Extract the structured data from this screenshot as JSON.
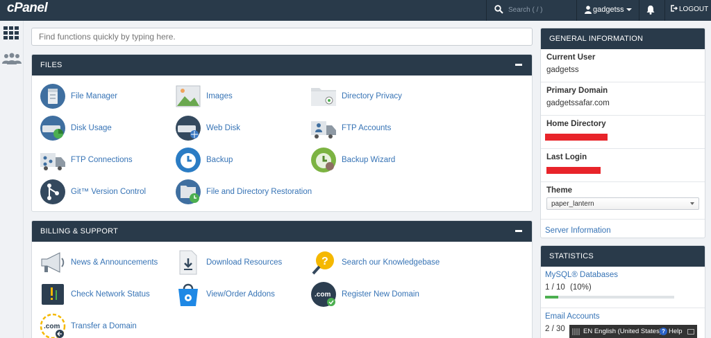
{
  "topbar": {
    "logo": "cPanel",
    "search_placeholder": "Search ( / )",
    "username": "gadgetss",
    "logout_label": "LOGOUT"
  },
  "quick_search": {
    "placeholder": "Find functions quickly by typing here."
  },
  "files": {
    "title": "FILES",
    "items": [
      {
        "label": "File Manager",
        "icon": "file-manager-icon"
      },
      {
        "label": "Images",
        "icon": "images-icon"
      },
      {
        "label": "Directory Privacy",
        "icon": "directory-privacy-icon"
      },
      {
        "label": "Disk Usage",
        "icon": "disk-usage-icon"
      },
      {
        "label": "Web Disk",
        "icon": "web-disk-icon"
      },
      {
        "label": "FTP Accounts",
        "icon": "ftp-accounts-icon"
      },
      {
        "label": "FTP Connections",
        "icon": "ftp-connections-icon"
      },
      {
        "label": "Backup",
        "icon": "backup-icon"
      },
      {
        "label": "Backup Wizard",
        "icon": "backup-wizard-icon"
      },
      {
        "label": "Git™ Version Control",
        "icon": "git-icon"
      },
      {
        "label": "File and Directory Restoration",
        "icon": "restoration-icon"
      }
    ]
  },
  "billing": {
    "title": "BILLING & SUPPORT",
    "items": [
      {
        "label": "News & Announcements",
        "icon": "megaphone-icon"
      },
      {
        "label": "Download Resources",
        "icon": "download-icon"
      },
      {
        "label": "Search our Knowledgebase",
        "icon": "knowledgebase-icon"
      },
      {
        "label": "Check Network Status",
        "icon": "network-status-icon"
      },
      {
        "label": "View/Order Addons",
        "icon": "addons-bag-icon"
      },
      {
        "label": "Register New Domain",
        "icon": "register-domain-icon"
      },
      {
        "label": "Transfer a Domain",
        "icon": "transfer-domain-icon"
      }
    ]
  },
  "general_info": {
    "title": "GENERAL INFORMATION",
    "current_user_label": "Current User",
    "current_user": "gadgetss",
    "primary_domain_label": "Primary Domain",
    "primary_domain": "gadgetssafar.com",
    "home_directory_label": "Home Directory",
    "last_login_label": "Last Login",
    "theme_label": "Theme",
    "theme_value": "paper_lantern",
    "server_info_link": "Server Information"
  },
  "statistics": {
    "title": "STATISTICS",
    "mysql_label": "MySQL® Databases",
    "mysql_value": "1 / 10",
    "mysql_percent": "(10%)",
    "mysql_fraction": 0.1,
    "email_label": "Email Accounts",
    "email_value": "2 / 30"
  },
  "langbar": {
    "language": "EN English (United States)",
    "help": "Help"
  },
  "colors": {
    "header_bg": "#293a4a",
    "link": "#3673b5",
    "redaction": "#e8242a",
    "progress": "#4caf50"
  }
}
